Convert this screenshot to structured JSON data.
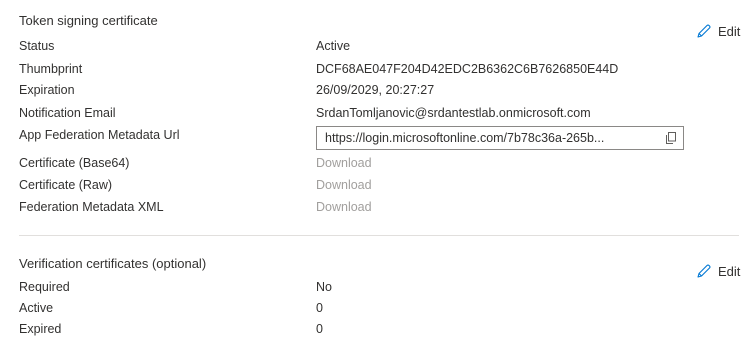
{
  "token_signing": {
    "title": "Token signing certificate",
    "edit_label": "Edit",
    "rows": [
      {
        "label": "Status",
        "value": "Active"
      },
      {
        "label": "Thumbprint",
        "value": "DCF68AE047F204D42EDC2B6362C6B7626850E44D"
      },
      {
        "label": "Expiration",
        "value": "26/09/2029, 20:27:27"
      },
      {
        "label": "Notification Email",
        "value": "SrdanTomljanovic@srdantestlab.onmicrosoft.com"
      }
    ],
    "metadata_url": {
      "label": "App Federation Metadata Url",
      "value": "https://login.microsoftonline.com/7b78c36a-265b..."
    },
    "downloads": [
      {
        "label": "Certificate (Base64)",
        "link": "Download"
      },
      {
        "label": "Certificate (Raw)",
        "link": "Download"
      },
      {
        "label": "Federation Metadata XML",
        "link": "Download"
      }
    ]
  },
  "verification": {
    "title": "Verification certificates (optional)",
    "edit_label": "Edit",
    "rows": [
      {
        "label": "Required",
        "value": "No"
      },
      {
        "label": "Active",
        "value": "0"
      },
      {
        "label": "Expired",
        "value": "0"
      }
    ]
  },
  "colors": {
    "text": "#323130",
    "muted_link": "#a19f9d",
    "divider": "#e1dfdd",
    "input_border": "#8a8886"
  },
  "icons": {
    "edit": "pencil-icon",
    "copy": "copy-icon"
  }
}
